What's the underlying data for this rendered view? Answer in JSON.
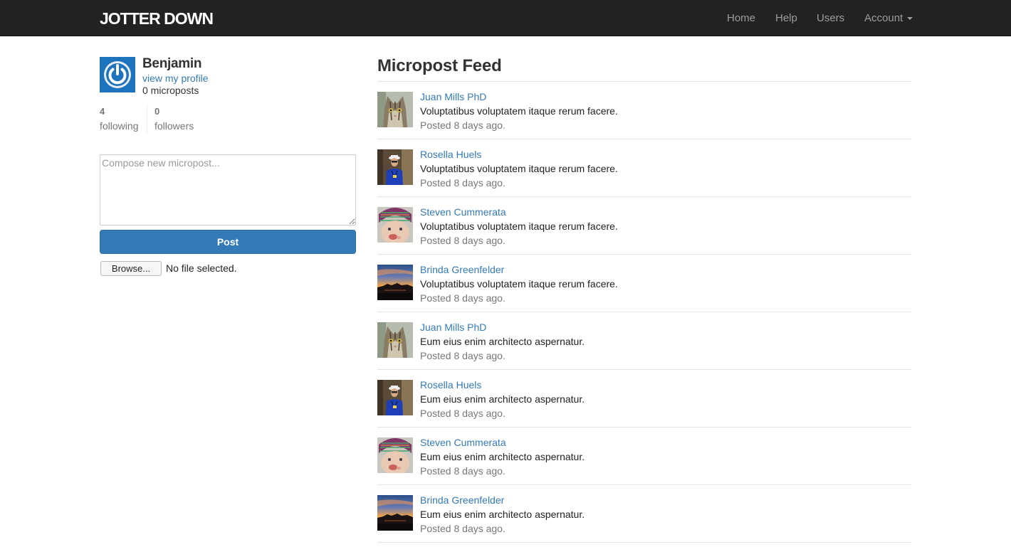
{
  "header": {
    "logo": "JOTTER DOWN",
    "nav": [
      {
        "label": "Home"
      },
      {
        "label": "Help"
      },
      {
        "label": "Users"
      },
      {
        "label": "Account"
      }
    ]
  },
  "sidebar": {
    "user": {
      "name": "Benjamin",
      "profile_link": "view my profile",
      "micropost_count": "0 microposts"
    },
    "stats": {
      "following_count": "4",
      "following_label": "following",
      "followers_count": "0",
      "followers_label": "followers"
    },
    "compose": {
      "placeholder": "Compose new micropost...",
      "value": ""
    },
    "post_label": "Post",
    "browse_label": "Browse...",
    "file_status": "No file selected."
  },
  "feed": {
    "title": "Micropost Feed",
    "items": [
      {
        "user": "Juan Mills PhD",
        "content": "Voluptatibus voluptatem itaque rerum facere.",
        "time": "Posted 8 days ago.",
        "avatar": "cat-avatar"
      },
      {
        "user": "Rosella Huels",
        "content": "Voluptatibus voluptatem itaque rerum facere.",
        "time": "Posted 8 days ago.",
        "avatar": "person-blue-shirt-avatar"
      },
      {
        "user": "Steven Cummerata",
        "content": "Voluptatibus voluptatem itaque rerum facere.",
        "time": "Posted 8 days ago.",
        "avatar": "baby-knit-hat-avatar"
      },
      {
        "user": "Brinda Greenfelder",
        "content": "Voluptatibus voluptatem itaque rerum facere.",
        "time": "Posted 8 days ago.",
        "avatar": "sunset-landscape-avatar"
      },
      {
        "user": "Juan Mills PhD",
        "content": "Eum eius enim architecto aspernatur.",
        "time": "Posted 8 days ago.",
        "avatar": "cat-avatar"
      },
      {
        "user": "Rosella Huels",
        "content": "Eum eius enim architecto aspernatur.",
        "time": "Posted 8 days ago.",
        "avatar": "person-blue-shirt-avatar"
      },
      {
        "user": "Steven Cummerata",
        "content": "Eum eius enim architecto aspernatur.",
        "time": "Posted 8 days ago.",
        "avatar": "baby-knit-hat-avatar"
      },
      {
        "user": "Brinda Greenfelder",
        "content": "Eum eius enim architecto aspernatur.",
        "time": "Posted 8 days ago.",
        "avatar": "sunset-landscape-avatar"
      }
    ]
  },
  "colors": {
    "navbar": "#222222",
    "link": "#337ab7",
    "primary_button": "#337ab7",
    "muted_text": "#777777",
    "gravatar": "#1e73be"
  }
}
